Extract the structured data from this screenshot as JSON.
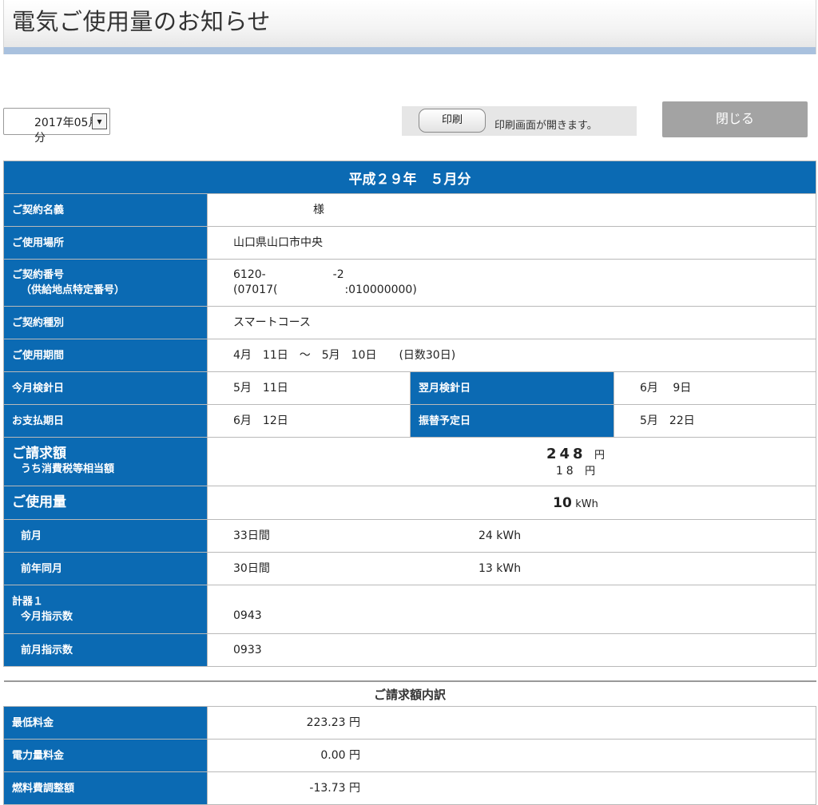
{
  "page": {
    "title": "電気ご使用量のお知らせ"
  },
  "controls": {
    "month_select": "2017年05月分",
    "print_button": "印刷",
    "print_hint": "印刷画面が開きます。",
    "close_button": "閉じる"
  },
  "statement": {
    "caption": "平成２９年　５月分",
    "rows": {
      "contract_name": {
        "label": "ご契約名義",
        "value": "様"
      },
      "usage_location": {
        "label": "ご使用場所",
        "value": "山口県山口市中央"
      },
      "contract_number": {
        "label": "ご契約番号",
        "label_sub": "（供給地点特定番号）",
        "value1": "6120-　　　　　　-2",
        "value2": "(07017(　　　　　　:010000000)"
      },
      "contract_type": {
        "label": "ご契約種別",
        "value": "スマートコース"
      },
      "usage_period": {
        "label": "ご使用期間",
        "value": "4月　11日　～　5月　10日　　(日数30日)"
      },
      "meter_reading_date": {
        "label": "今月検針日",
        "value": "5月　11日"
      },
      "next_reading_date": {
        "label": "翌月検針日",
        "value": "6月　 9日"
      },
      "payment_due": {
        "label": "お支払期日",
        "value": "6月　12日"
      },
      "transfer_date": {
        "label": "振替予定日",
        "value": "5月　22日"
      },
      "billing_amount": {
        "label": "ご請求額",
        "label_sub": "うち消費税等相当額",
        "amount": "248",
        "unit": "円",
        "tax": "18",
        "tax_unit": "円"
      },
      "usage_amount": {
        "label": "ご使用量",
        "value": "10",
        "unit": "kWh"
      },
      "prev_month": {
        "label": "前月",
        "days": "33日間",
        "kwh": "24 kWh"
      },
      "prev_year_same_month": {
        "label": "前年同月",
        "days": "30日間",
        "kwh": "13 kWh"
      },
      "meter1": {
        "label": "計器１",
        "label_sub": "今月指示数",
        "value": "0943"
      },
      "prev_reading": {
        "label": "前月指示数",
        "value": "0933"
      }
    }
  },
  "breakdown": {
    "caption": "ご請求額内訳",
    "items": [
      {
        "label": "最低料金",
        "value": "223.23 円"
      },
      {
        "label": "電力量料金",
        "value": "0.00 円"
      },
      {
        "label": "燃料費調整額",
        "value": "-13.73 円"
      }
    ]
  }
}
